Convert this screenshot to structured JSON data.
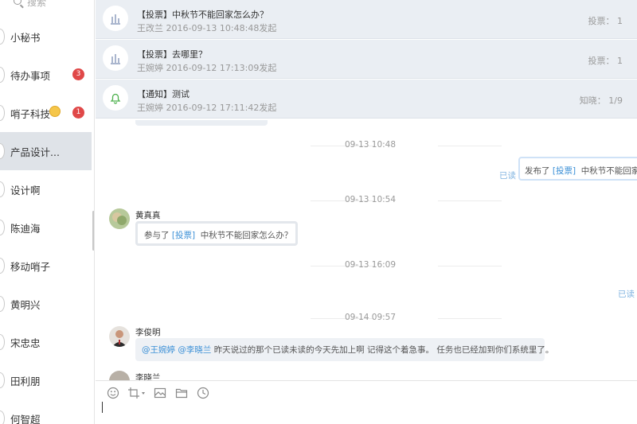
{
  "search": {
    "placeholder": "搜索"
  },
  "conversations": [
    {
      "name": "小秘书"
    },
    {
      "name": "待办事项",
      "badge": "3"
    },
    {
      "name": "哨子科技",
      "badge": "1"
    },
    {
      "name": "产品设计..."
    },
    {
      "name": "设计啊"
    },
    {
      "name": "陈迪海"
    },
    {
      "name": "移动哨子"
    },
    {
      "name": "黄明兴"
    },
    {
      "name": "宋忠忠"
    },
    {
      "name": "田利朋"
    },
    {
      "name": "何智超"
    }
  ],
  "notices": [
    {
      "icon": "poll-icon",
      "title": "【投票】中秋节不能回家怎么办？",
      "meta": "王改兰 2016-09-13 10:48:48发起",
      "stat": "投票： 1"
    },
    {
      "icon": "poll-icon",
      "title": "【投票】去哪里？",
      "meta": "王婉婷 2016-09-12 17:13:09发起",
      "stat": "投票： 1"
    },
    {
      "icon": "bell-icon",
      "title": "【通知】测试",
      "meta": "王婉婷 2016-09-12 17:11:42发起",
      "stat": "知晓： 1/9"
    }
  ],
  "timeline": {
    "t1": "09-13 10:48",
    "t2": "09-13 10:54",
    "t3": "09-13 16:09",
    "t4": "09-14 09:57"
  },
  "out_msg_1": {
    "prefix": "发布了",
    "link": "[投票]",
    "text": "中秋节不能回家",
    "read": "已读"
  },
  "msg_1": {
    "sender": "黄真真",
    "prefix": "参与了",
    "link": "[投票]",
    "text": "中秋节不能回家怎么办？"
  },
  "out_msg_2": {
    "read": "已读"
  },
  "msg_2": {
    "sender": "李俊明",
    "mention1": "@王婉婷",
    "mention2": "@李晓兰",
    "text": "昨天说过的那个已读未读的今天先加上啊  记得这个着急事。 任务也已经加到你们系统里了。"
  },
  "msg_3": {
    "sender": "李晓兰"
  },
  "toolbar": {
    "icons": [
      "emoji-icon",
      "crop-icon",
      "image-icon",
      "folder-icon",
      "clock-icon"
    ]
  },
  "colors": {
    "accent": "#3a8fd6",
    "badge": "#e04848",
    "notice_bg": "#eaeef3",
    "active_conv": "#dfe3e8"
  }
}
